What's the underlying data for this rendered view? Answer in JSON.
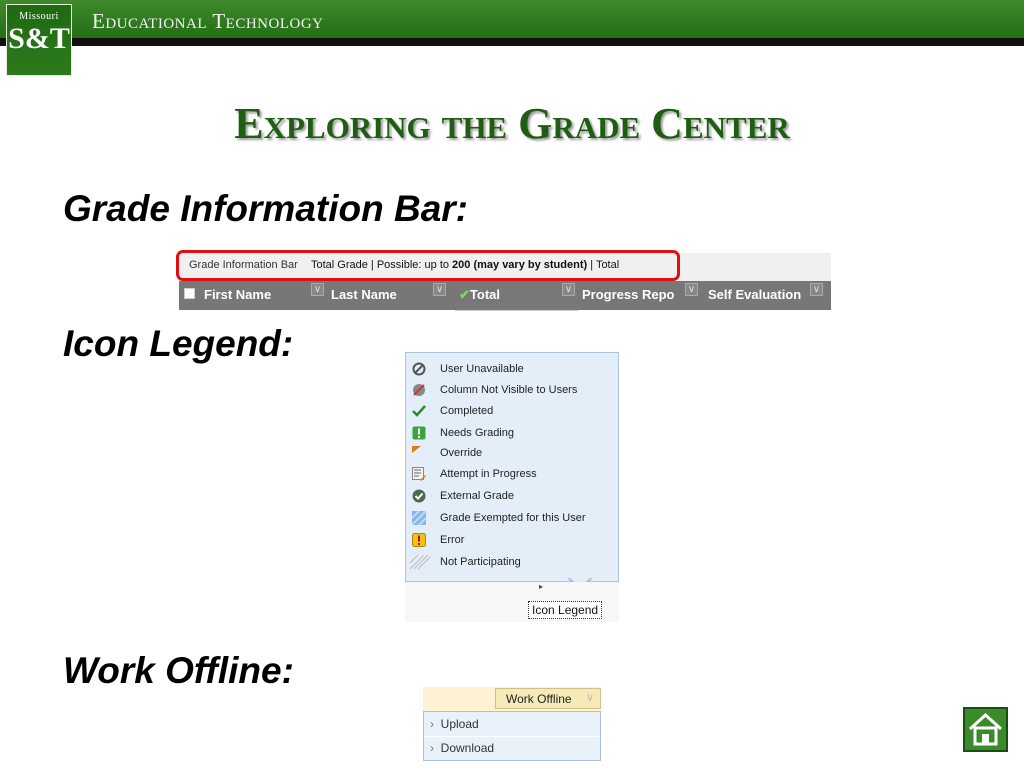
{
  "header": {
    "logo_top": "Missouri",
    "logo_main": "S&T",
    "title": "Educational Technology"
  },
  "slide": {
    "title": "Exploring the Grade Center"
  },
  "sections": {
    "grade_bar": "Grade Information Bar:",
    "legend": "Icon Legend:",
    "offline": "Work Offline:"
  },
  "grade_info_bar": {
    "label": "Grade Information Bar",
    "text_prefix": "Total Grade | Possible: up to ",
    "text_bold": "200 (may vary by student)",
    "text_suffix": " | Total",
    "columns": [
      "First Name",
      "Last Name",
      "Total",
      "Progress Repo",
      "Self Evaluation"
    ]
  },
  "icon_legend": {
    "items": [
      {
        "icon": "user-unavailable-icon",
        "label": "User Unavailable"
      },
      {
        "icon": "column-not-visible-icon",
        "label": "Column Not Visible to Users"
      },
      {
        "icon": "completed-check-icon",
        "label": "Completed"
      },
      {
        "icon": "needs-grading-icon",
        "label": "Needs Grading"
      },
      {
        "icon": "override-icon",
        "label": "Override"
      },
      {
        "icon": "attempt-in-progress-icon",
        "label": "Attempt in Progress"
      },
      {
        "icon": "external-grade-icon",
        "label": "External Grade"
      },
      {
        "icon": "grade-exempted-icon",
        "label": "Grade Exempted for this User"
      },
      {
        "icon": "error-icon",
        "label": "Error"
      },
      {
        "icon": "not-participating-icon",
        "label": "Not Participating"
      }
    ],
    "button_label": "Icon Legend"
  },
  "work_offline": {
    "button_label": "Work Offline",
    "menu": [
      {
        "label": "Upload"
      },
      {
        "label": "Download"
      }
    ]
  },
  "colors": {
    "header_green": "#2d7a1c",
    "title_green": "#1f5d12",
    "highlight_red": "#e01010",
    "legend_blue": "#e4eef9"
  }
}
